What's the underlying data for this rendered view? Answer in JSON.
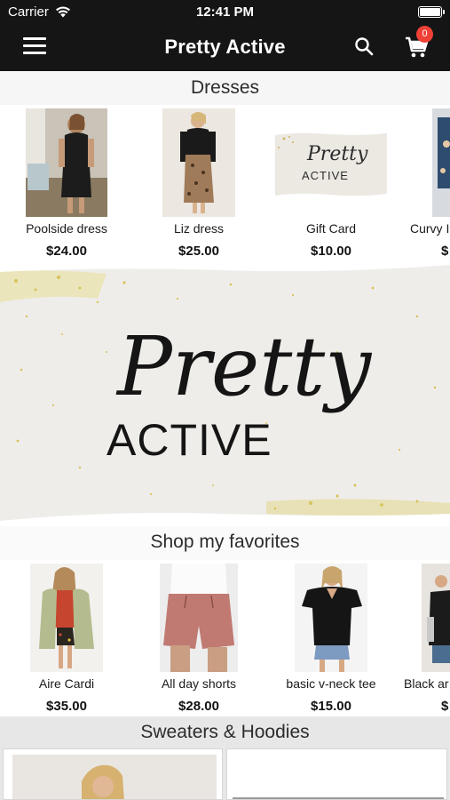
{
  "status_bar": {
    "carrier": "Carrier",
    "time": "12:41 PM"
  },
  "header": {
    "title": "Pretty Active",
    "menu_icon": "hamburger-menu-icon",
    "search_icon": "search-icon",
    "cart_icon": "cart-icon",
    "cart_count": "0"
  },
  "colors": {
    "topbar": "#151515",
    "badge": "#ef4136",
    "section_bg": "#e7e7e7"
  },
  "sections": {
    "dresses": {
      "title": "Dresses",
      "products": [
        {
          "name": "Poolside dress",
          "price": "$24.00"
        },
        {
          "name": "Liz dress",
          "price": "$25.00"
        },
        {
          "name": "Gift Card",
          "price": "$10.00"
        },
        {
          "name": "Curvy I",
          "price": "$"
        }
      ]
    },
    "banner": {
      "logo_script": "Pretty",
      "logo_text": "ACTIVE"
    },
    "favorites": {
      "title": "Shop my favorites",
      "products": [
        {
          "name": "Aire Cardi",
          "price": "$35.00"
        },
        {
          "name": "All day shorts",
          "price": "$28.00"
        },
        {
          "name": "basic v-neck tee",
          "price": "$15.00"
        },
        {
          "name": "Black ar",
          "price": "$"
        }
      ]
    },
    "sweaters": {
      "title": "Sweaters & Hoodies"
    }
  },
  "gift_card_logo": {
    "script": "Pretty",
    "text": "ACTIVE"
  }
}
